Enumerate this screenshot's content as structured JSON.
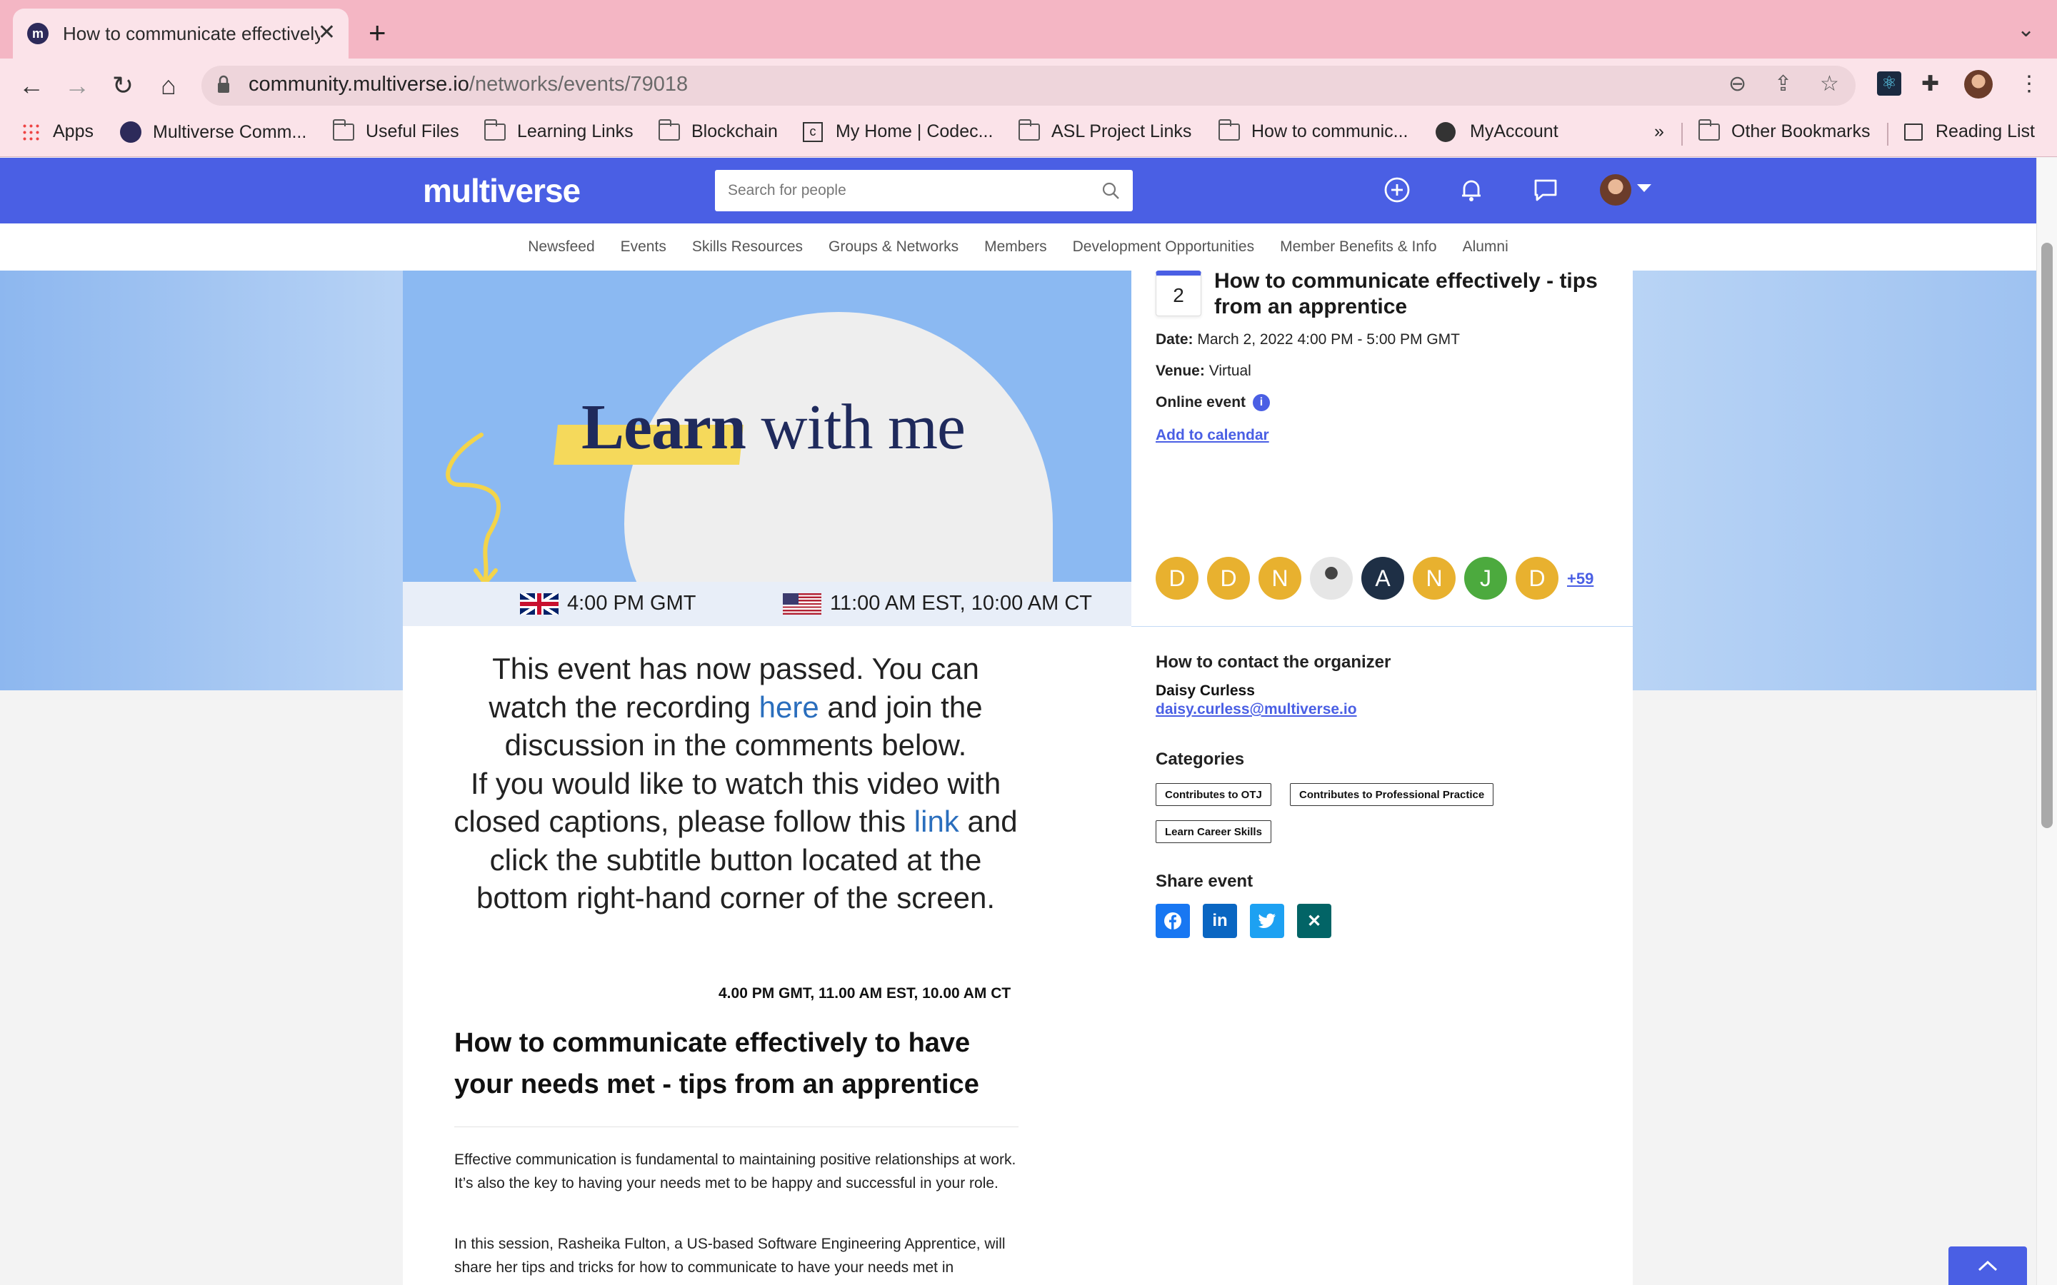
{
  "browser": {
    "tab_title": "How to communicate effectively - tips from an apprentice",
    "url_host": "community.multiverse.io",
    "url_path": "/networks/events/79018",
    "bookmarks": [
      "Apps",
      "Multiverse Comm...",
      "Useful Files",
      "Learning Links",
      "Blockchain",
      "My Home | Codec...",
      "ASL Project Links",
      "How to communic...",
      "MyAccount",
      "»",
      "Other Bookmarks",
      "Reading List"
    ]
  },
  "site": {
    "logo": "multiverse",
    "search_placeholder": "Search for people",
    "nav": [
      "Newsfeed",
      "Events",
      "Skills Resources",
      "Groups & Networks",
      "Members",
      "Development Opportunities",
      "Member Benefits & Info",
      "Alumni"
    ]
  },
  "banner": {
    "headline_word1": "Learn",
    "headline_rest": "with me",
    "time_uk": "4:00 PM GMT",
    "time_us": "11:00 AM EST, 10:00 AM CT"
  },
  "main": {
    "passed_p1": "This event has now passed. You can watch the recording",
    "passed_link1": "here",
    "passed_p2": "and join the discussion in the comments below.",
    "passed_p3": "If you would like to watch this video with closed captions, please follow this",
    "passed_link2": "link",
    "passed_p4": "and click the subtitle button located at the bottom right-hand corner of the screen.",
    "times": "4.00 PM GMT, 11.00 AM EST, 10.00 AM CT",
    "heading": "How to communicate effectively to have your needs met - tips from an apprentice",
    "para1": "Effective communication is fundamental to maintaining positive relationships at work. It’s also the key to having your needs met to be happy and successful in your role.",
    "para2": "In this session, Rasheika Fulton, a US-based Software Engineering Apprentice, will share her tips and tricks for how to communicate to have your needs met in"
  },
  "side": {
    "day": "2",
    "title": "How to communicate effectively - tips from an apprentice",
    "date_label": "Date:",
    "date_value": "March 2, 2022 4:00 PM - 5:00 PM GMT",
    "venue_label": "Venue:",
    "venue_value": "Virtual",
    "online_label": "Online event",
    "add_calendar": "Add to calendar",
    "attendees": [
      "D",
      "D",
      "N",
      "",
      "A",
      "N",
      "J",
      "D"
    ],
    "attendee_colors": [
      "#e8b12f",
      "#e8b12f",
      "#e8b12f",
      "#d8d8d8",
      "#1e2f45",
      "#e8b12f",
      "#4caa3e",
      "#e8b12f"
    ],
    "more_count": "+59",
    "contact_heading": "How to contact the organizer",
    "organizer_name": "Daisy Curless",
    "organizer_email": "daisy.curless@multiverse.io",
    "categories_heading": "Categories",
    "categories": [
      "Contributes to OTJ",
      "Contributes to Professional Practice",
      "Learn Career Skills"
    ],
    "share_heading": "Share event",
    "share_colors": {
      "facebook": "#1877f2",
      "linkedin": "#0a66c2",
      "twitter": "#1da1f2",
      "xing": "#026466"
    }
  }
}
